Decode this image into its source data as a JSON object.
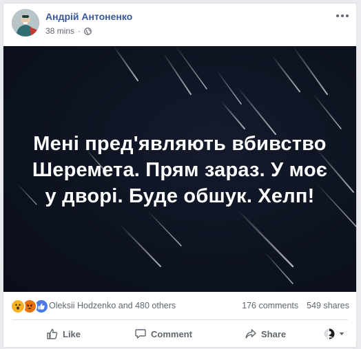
{
  "post": {
    "author": "Андрій Антоненко",
    "time": "38 mins",
    "icons": {
      "privacy": "globe-icon",
      "options": "more-options-icon"
    },
    "image_text": {
      "lines": [
        "Мені пред'являють вбивство",
        "Шеремета. Прям зараз. У моє",
        "у дворі. Буде обшук. Хелп!"
      ]
    },
    "reactions": {
      "icons": [
        "wow-reaction-icon",
        "angry-reaction-icon",
        "like-reaction-icon"
      ],
      "reactors": "Oleksii Hodzenko and 480 others",
      "comments": "176 comments",
      "shares": "549 shares"
    },
    "actions": {
      "like": "Like",
      "comment": "Comment",
      "share": "Share",
      "audience_icon": "profile-selector-icon"
    }
  },
  "colors": {
    "author": "#385898",
    "meta": "#616770",
    "image_bg": "#0d1220",
    "accent_blue": "#4b79e8"
  }
}
